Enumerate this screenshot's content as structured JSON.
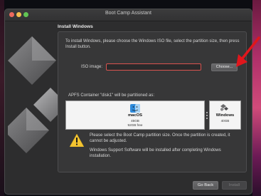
{
  "window": {
    "title": "Boot Camp Assistant"
  },
  "page": {
    "heading": "Install Windows",
    "intro": "To install Windows, please choose the Windows ISO file, select the partition size, then press Install button."
  },
  "iso": {
    "label": "ISO image:",
    "value": "",
    "choose_label": "Choose..."
  },
  "partition": {
    "label": "APFS Container \"disk1\" will be partitioned as:",
    "mac": {
      "name": "macOS",
      "size": "45GB",
      "free": "92GB free"
    },
    "windows": {
      "name": "Windows",
      "size": "40GB"
    }
  },
  "warning": "Please select the Boot Camp partition size. Once the partition is created, it cannot be adjusted.",
  "support": "Windows Support Software will be installed after completing Windows installation.",
  "buttons": {
    "go_back": "Go Back",
    "install": "Install"
  },
  "colors": {
    "arrow": "#e0161c",
    "field_border": "#d9534f",
    "window_bg": "#2d2d2e"
  },
  "icons": [
    "bootcamp-logo-icon",
    "finder-icon",
    "windows-icon",
    "warning-icon",
    "red-arrow-annotation"
  ]
}
